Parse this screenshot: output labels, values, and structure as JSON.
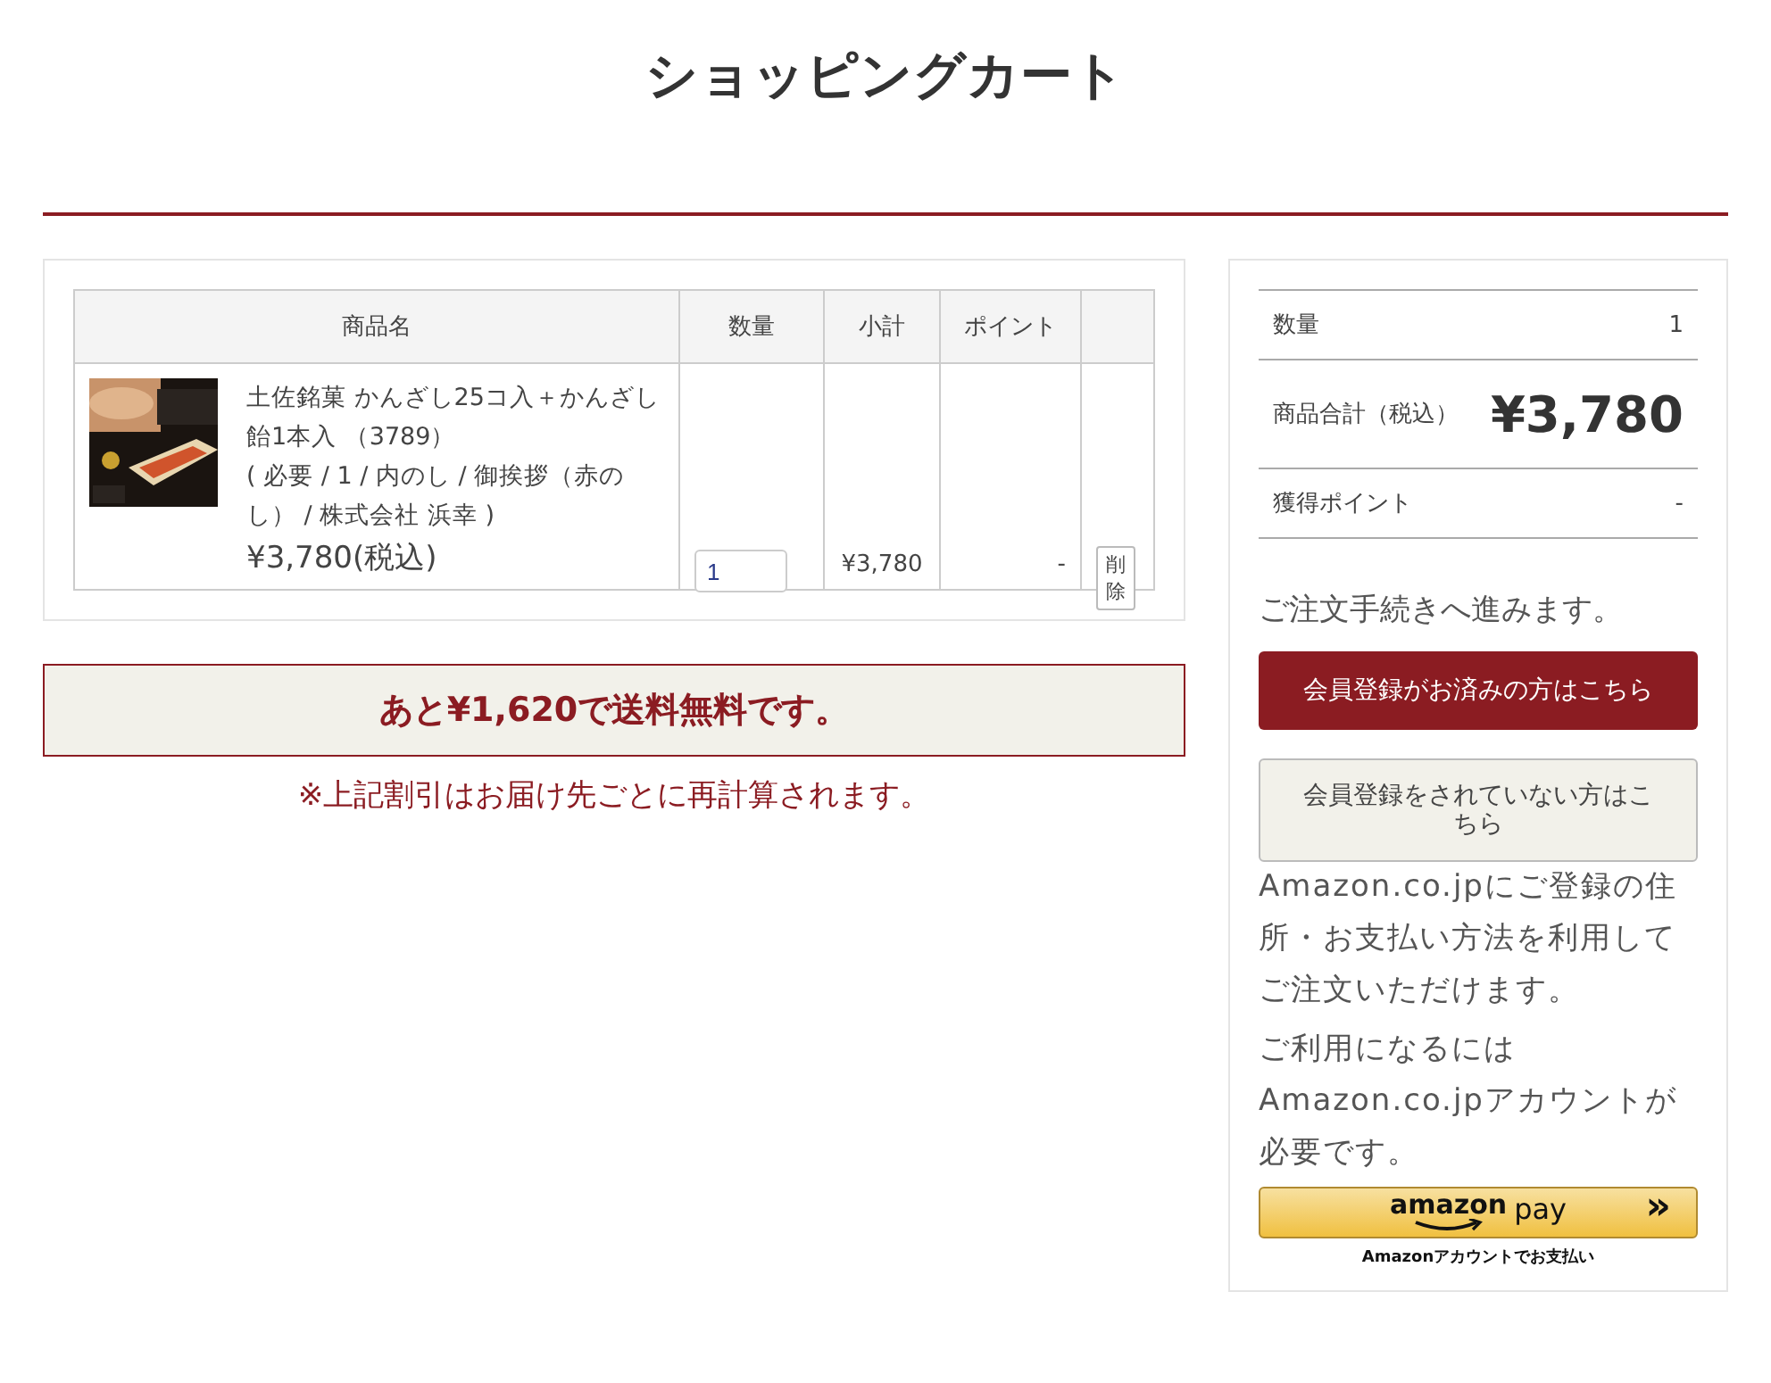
{
  "title": "ショッピングカート",
  "cart": {
    "columns": [
      "商品名",
      "数量",
      "小計",
      "ポイント"
    ],
    "rows": [
      {
        "kind": "picture",
        "name": "土佐銘菓 かんざし25コ入＋かんざし飴1本入 （3789）",
        "options": "( 必要 / 1 / 内のし / 御挨拶（赤のし） / 株式会社 浜幸 )",
        "price": "¥3,780(税込)",
        "quantity": "1",
        "subtotal": "¥3,780",
        "points": "-",
        "delete_button": "削除"
      }
    ]
  },
  "free_shipping": {
    "message": "あと¥1,620で送料無料です。",
    "note": "※上記割引はお届け先ごとに再計算されます。"
  },
  "summary": {
    "rows": [
      {
        "kind": "plain",
        "label": "数量",
        "value": "1"
      },
      {
        "kind": "total",
        "label": "商品合計（税込）",
        "value": "¥3,780"
      },
      {
        "kind": "plain",
        "label": "獲得ポイント",
        "value": "-"
      }
    ],
    "proceed_text": "ご注文手続きへ進みます。",
    "member_button": "会員登録がお済みの方はこちら",
    "guest_button": "会員登録をされていない方はこちら",
    "amazon_texts": [
      "Amazon.co.jpにご登録の住所・お支払い方法を利用してご注文いただけます。",
      "ご利用になるにはAmazon.co.jpアカウントが必要です。"
    ],
    "amazon_pay": {
      "logo": "amazon",
      "label": "pay",
      "arrow": "»",
      "caption": "Amazonアカウントでお支払い"
    }
  }
}
